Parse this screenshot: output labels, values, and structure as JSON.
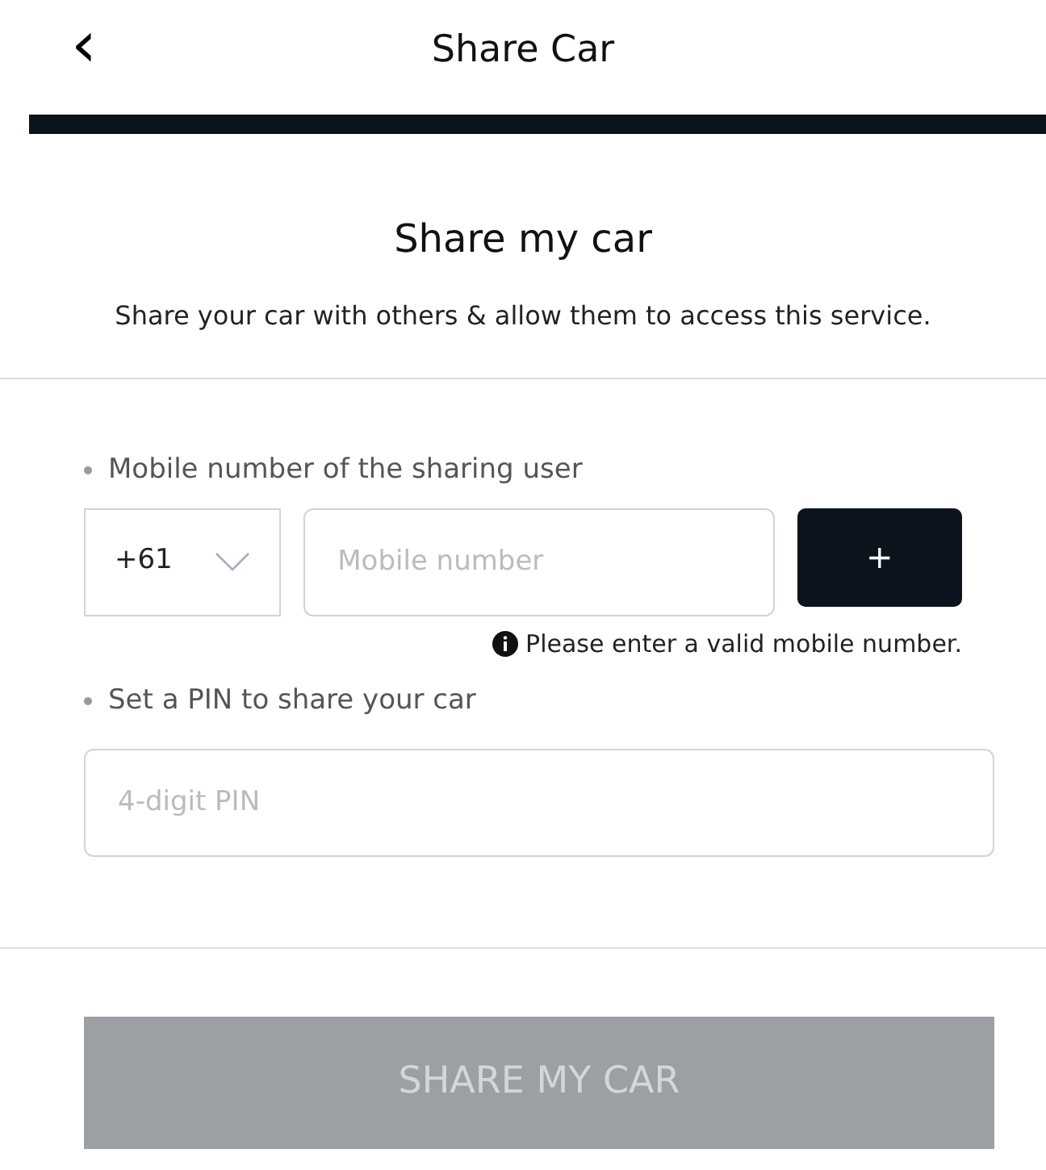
{
  "header": {
    "back": "‹",
    "title": "Share Car"
  },
  "intro": {
    "heading": "Share my car",
    "text": "Share your car with others & allow them to access this service."
  },
  "mobile": {
    "label": "Mobile number of the sharing user",
    "country_code": "+61",
    "placeholder": "Mobile number",
    "add": "+",
    "error": "Please enter a valid mobile number."
  },
  "pin": {
    "label": "Set a PIN to share your car",
    "placeholder": "4-digit PIN"
  },
  "submit": {
    "label": "SHARE MY CAR",
    "disabled": true
  }
}
